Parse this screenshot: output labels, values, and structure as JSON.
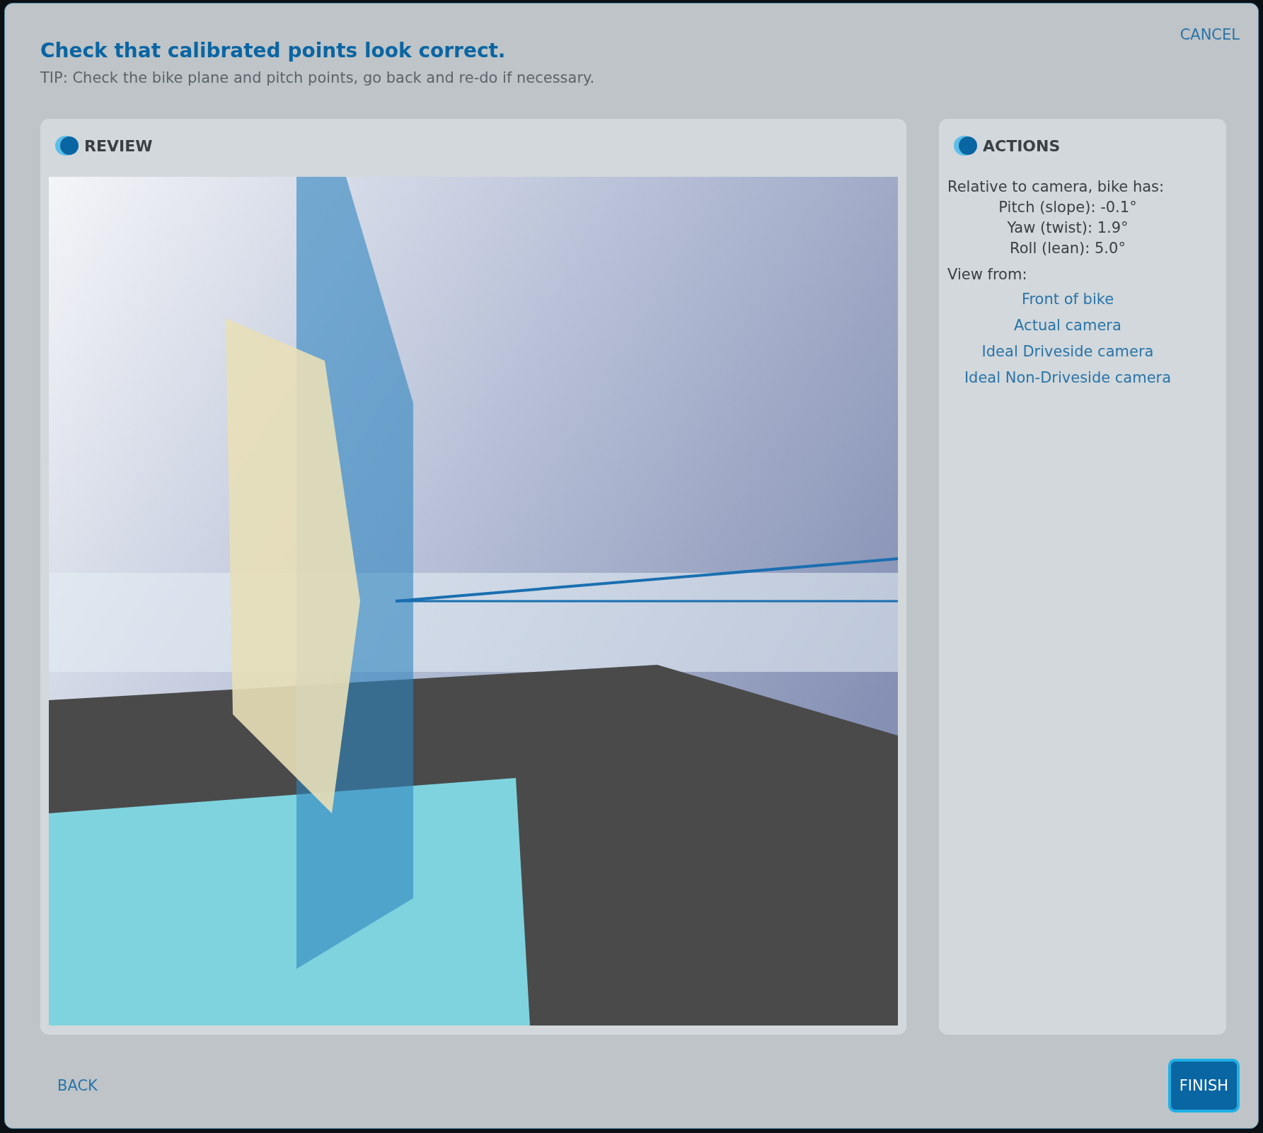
{
  "dialog": {
    "title": "Check that calibrated points look correct.",
    "tip": "TIP: Check the bike plane and pitch points, go back and re-do if necessary.",
    "cancel": "CANCEL"
  },
  "review": {
    "title": "REVIEW"
  },
  "actions": {
    "title": "ACTIONS",
    "intro": "Relative to camera, bike has:",
    "measurements": [
      "Pitch (slope): -0.1°",
      "Yaw (twist): 1.9°",
      "Roll (lean): 5.0°"
    ],
    "view_label": "View from:",
    "views": [
      "Front of bike",
      "Actual camera",
      "Ideal Driveside camera",
      "Ideal Non-Driveside camera"
    ]
  },
  "footer": {
    "back": "BACK",
    "finish": "FINISH"
  }
}
